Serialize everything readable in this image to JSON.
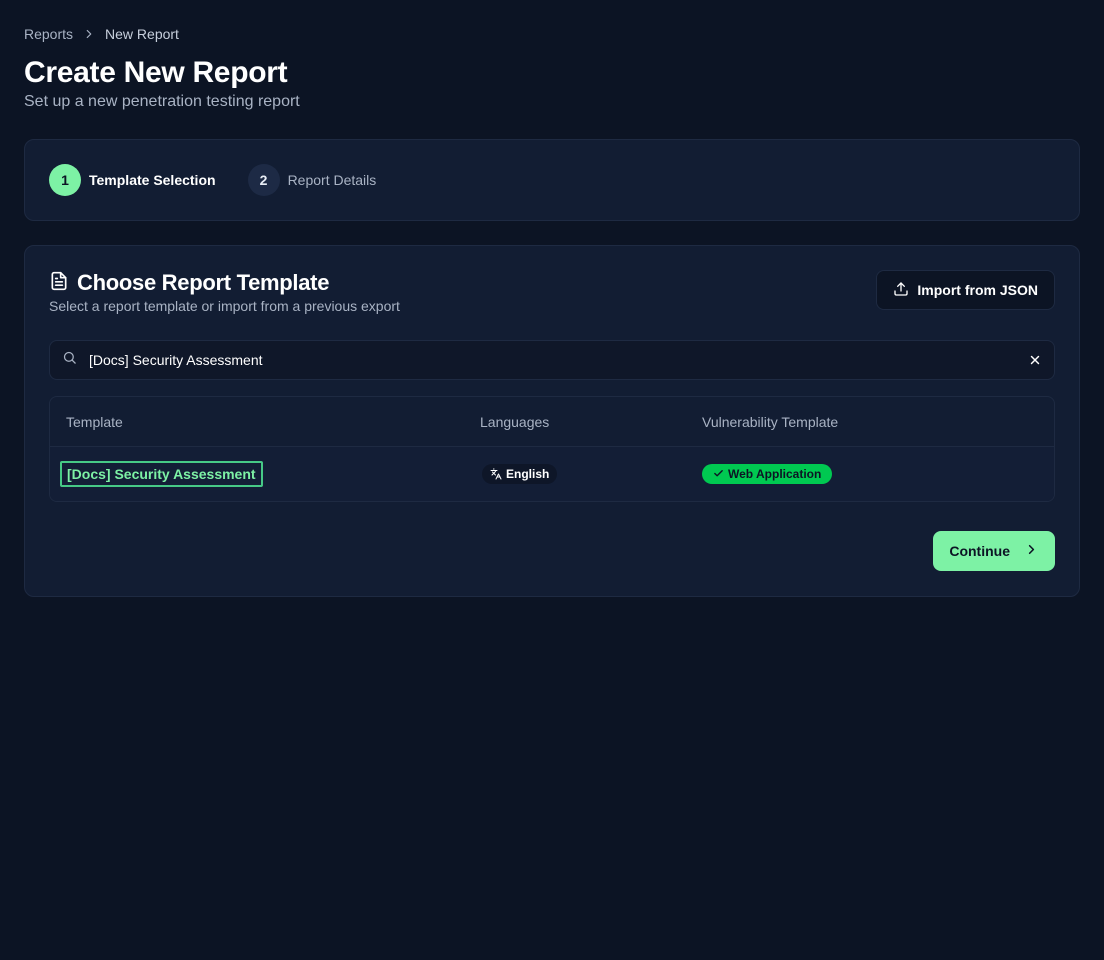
{
  "breadcrumb": {
    "parent": "Reports",
    "current": "New Report"
  },
  "header": {
    "title": "Create New Report",
    "subtitle": "Set up a new penetration testing report"
  },
  "stepper": {
    "steps": [
      {
        "number": "1",
        "label": "Template Selection",
        "state": "active"
      },
      {
        "number": "2",
        "label": "Report Details",
        "state": "inactive"
      }
    ]
  },
  "template_card": {
    "title": "Choose Report Template",
    "subtitle": "Select a report template or import from a previous export",
    "import_label": "Import from JSON",
    "search": {
      "value": "[Docs] Security Assessment",
      "placeholder": ""
    },
    "columns": [
      "Template",
      "Languages",
      "Vulnerability Template"
    ],
    "rows": [
      {
        "template": "[Docs] Security Assessment",
        "language": "English",
        "vulnerability_template": "Web Application"
      }
    ],
    "continue_label": "Continue"
  },
  "colors": {
    "background": "#0c1424",
    "card": "#121d33",
    "accent": "#7df2a5",
    "success_badge": "#00c951"
  },
  "icons": [
    "chevron-right-icon",
    "document-icon",
    "upload-icon",
    "search-icon",
    "close-icon",
    "translate-icon",
    "check-icon"
  ]
}
